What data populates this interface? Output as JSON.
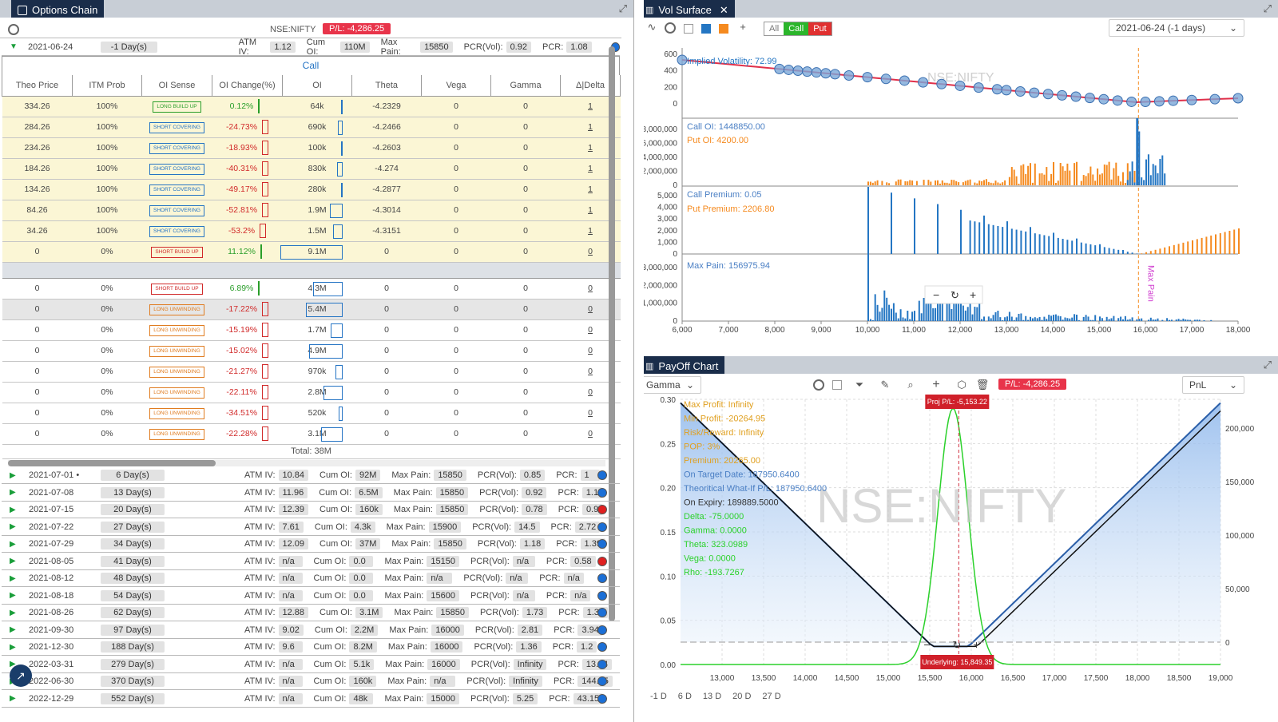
{
  "left": {
    "title": "Options Chain",
    "symbol": "NSE:NIFTY",
    "pnl": "P/L: -4,286.25",
    "expanded": {
      "date": "2021-06-24",
      "days": "-1 Day(s)",
      "atm_iv_label": "ATM IV:",
      "atm_iv": "1.12",
      "cum_oi_label": "Cum OI:",
      "cum_oi": "110M",
      "max_pain_label": "Max Pain:",
      "max_pain": "15850",
      "pcr_vol_label": "PCR(Vol):",
      "pcr_vol": "0.92",
      "pcr_label": "PCR:",
      "pcr": "1.08"
    },
    "call_label": "Call",
    "columns": [
      "Theo Price",
      "ITM Prob",
      "OI Sense",
      "OI Change(%)",
      "OI",
      "Theta",
      "Vega",
      "Gamma",
      "Δ|Delta"
    ],
    "itm_rows": [
      {
        "theo": "334.26",
        "prob": "100%",
        "sense": "LONG BUILD UP",
        "cls": "b-lbu",
        "chg": "0.12%",
        "dir": "pos",
        "oi": "64k",
        "oif": 0.02,
        "theta": "-4.2329",
        "vega": "0",
        "gamma": "0",
        "delta": "1"
      },
      {
        "theo": "284.26",
        "prob": "100%",
        "sense": "SHORT COVERING",
        "cls": "b-sc",
        "chg": "-24.73%",
        "dir": "neg",
        "oi": "690k",
        "oif": 0.08,
        "theta": "-4.2466",
        "vega": "0",
        "gamma": "0",
        "delta": "1"
      },
      {
        "theo": "234.26",
        "prob": "100%",
        "sense": "SHORT COVERING",
        "cls": "b-sc",
        "chg": "-18.93%",
        "dir": "neg",
        "oi": "100k",
        "oif": 0.02,
        "theta": "-4.2603",
        "vega": "0",
        "gamma": "0",
        "delta": "1"
      },
      {
        "theo": "184.26",
        "prob": "100%",
        "sense": "SHORT COVERING",
        "cls": "b-sc",
        "chg": "-40.31%",
        "dir": "neg",
        "oi": "830k",
        "oif": 0.09,
        "theta": "-4.274",
        "vega": "0",
        "gamma": "0",
        "delta": "1"
      },
      {
        "theo": "134.26",
        "prob": "100%",
        "sense": "SHORT COVERING",
        "cls": "b-sc",
        "chg": "-49.17%",
        "dir": "neg",
        "oi": "280k",
        "oif": 0.03,
        "theta": "-4.2877",
        "vega": "0",
        "gamma": "0",
        "delta": "1"
      },
      {
        "theo": "84.26",
        "prob": "100%",
        "sense": "SHORT COVERING",
        "cls": "b-sc",
        "chg": "-52.81%",
        "dir": "neg",
        "oi": "1.9M",
        "oif": 0.2,
        "theta": "-4.3014",
        "vega": "0",
        "gamma": "0",
        "delta": "1"
      },
      {
        "theo": "34.26",
        "prob": "100%",
        "sense": "SHORT COVERING",
        "cls": "b-sc",
        "chg": "-53.2%",
        "dir": "neg",
        "oi": "1.5M",
        "oif": 0.16,
        "theta": "-4.3151",
        "vega": "0",
        "gamma": "0",
        "delta": "1"
      },
      {
        "theo": "0",
        "prob": "0%",
        "sense": "SHORT BUILD UP",
        "cls": "b-sbu",
        "chg": "11.12%",
        "dir": "pos",
        "oi": "9.1M",
        "oif": 1.0,
        "theta": "0",
        "vega": "0",
        "gamma": "0",
        "delta": "0"
      }
    ],
    "otm_rows": [
      {
        "theo": "0",
        "prob": "0%",
        "sense": "SHORT BUILD UP",
        "cls": "b-sbu",
        "chg": "6.89%",
        "dir": "pos",
        "oi": "4.3M",
        "oif": 0.47,
        "theta": "0",
        "vega": "0",
        "gamma": "0",
        "delta": "0"
      },
      {
        "theo": "0",
        "prob": "0%",
        "sense": "LONG UNWINDING",
        "cls": "b-lu",
        "chg": "-17.22%",
        "dir": "neg",
        "oi": "5.4M",
        "oif": 0.59,
        "theta": "0",
        "vega": "0",
        "gamma": "0",
        "delta": "0"
      },
      {
        "theo": "0",
        "prob": "0%",
        "sense": "LONG UNWINDING",
        "cls": "b-lu",
        "chg": "-15.19%",
        "dir": "neg",
        "oi": "1.7M",
        "oif": 0.19,
        "theta": "0",
        "vega": "0",
        "gamma": "0",
        "delta": "0"
      },
      {
        "theo": "0",
        "prob": "0%",
        "sense": "LONG UNWINDING",
        "cls": "b-lu",
        "chg": "-15.02%",
        "dir": "neg",
        "oi": "4.9M",
        "oif": 0.54,
        "theta": "0",
        "vega": "0",
        "gamma": "0",
        "delta": "0"
      },
      {
        "theo": "0",
        "prob": "0%",
        "sense": "LONG UNWINDING",
        "cls": "b-lu",
        "chg": "-21.27%",
        "dir": "neg",
        "oi": "970k",
        "oif": 0.11,
        "theta": "0",
        "vega": "0",
        "gamma": "0",
        "delta": "0"
      },
      {
        "theo": "0",
        "prob": "0%",
        "sense": "LONG UNWINDING",
        "cls": "b-lu",
        "chg": "-22.11%",
        "dir": "neg",
        "oi": "2.8M",
        "oif": 0.31,
        "theta": "0",
        "vega": "0",
        "gamma": "0",
        "delta": "0"
      },
      {
        "theo": "0",
        "prob": "0%",
        "sense": "LONG UNWINDING",
        "cls": "b-lu",
        "chg": "-34.51%",
        "dir": "neg",
        "oi": "520k",
        "oif": 0.06,
        "theta": "0",
        "vega": "0",
        "gamma": "0",
        "delta": "0"
      },
      {
        "theo": "0",
        "prob": "0%",
        "sense": "LONG UNWINDING",
        "cls": "b-lu",
        "chg": "-22.28%",
        "dir": "neg",
        "oi": "3.1M",
        "oif": 0.34,
        "theta": "0",
        "vega": "0",
        "gamma": "0",
        "delta": "0"
      }
    ],
    "total": "Total: 38M",
    "expiries": [
      {
        "date": "2021-07-01 •",
        "days": "6 Day(s)",
        "iv": "10.84",
        "oi": "92M",
        "mp": "15850",
        "pv": "0.85",
        "pcr": "1",
        "dot": "blue"
      },
      {
        "date": "2021-07-08",
        "days": "13 Day(s)",
        "iv": "11.96",
        "oi": "6.5M",
        "mp": "15850",
        "pv": "0.92",
        "pcr": "1.1",
        "dot": "blue"
      },
      {
        "date": "2021-07-15",
        "days": "20 Day(s)",
        "iv": "12.39",
        "oi": "160k",
        "mp": "15850",
        "pv": "0.78",
        "pcr": "0.9",
        "dot": "red"
      },
      {
        "date": "2021-07-22",
        "days": "27 Day(s)",
        "iv": "7.61",
        "oi": "4.3k",
        "mp": "15900",
        "pv": "14.5",
        "pcr": "2.72",
        "dot": "blue"
      },
      {
        "date": "2021-07-29",
        "days": "34 Day(s)",
        "iv": "12.09",
        "oi": "37M",
        "mp": "15850",
        "pv": "1.18",
        "pcr": "1.39",
        "dot": "blue"
      },
      {
        "date": "2021-08-05",
        "days": "41 Day(s)",
        "iv": "n/a",
        "oi": "0.0",
        "mp": "15150",
        "pv": "n/a",
        "pcr": "0.58",
        "dot": "red"
      },
      {
        "date": "2021-08-12",
        "days": "48 Day(s)",
        "iv": "n/a",
        "oi": "0.0",
        "mp": "n/a",
        "pv": "n/a",
        "pcr": "n/a",
        "dot": "blue"
      },
      {
        "date": "2021-08-18",
        "days": "54 Day(s)",
        "iv": "n/a",
        "oi": "0.0",
        "mp": "15600",
        "pv": "n/a",
        "pcr": "n/a",
        "dot": "blue"
      },
      {
        "date": "2021-08-26",
        "days": "62 Day(s)",
        "iv": "12.88",
        "oi": "3.1M",
        "mp": "15850",
        "pv": "1.73",
        "pcr": "1.34",
        "dot": "blue"
      },
      {
        "date": "2021-09-30",
        "days": "97 Day(s)",
        "iv": "9.02",
        "oi": "2.2M",
        "mp": "16000",
        "pv": "2.81",
        "pcr": "3.94",
        "dot": "blue"
      },
      {
        "date": "2021-12-30",
        "days": "188 Day(s)",
        "iv": "9.6",
        "oi": "8.2M",
        "mp": "16000",
        "pv": "1.36",
        "pcr": "1.2",
        "dot": "blue"
      },
      {
        "date": "2022-03-31",
        "days": "279 Day(s)",
        "iv": "n/a",
        "oi": "5.1k",
        "mp": "16000",
        "pv": "Infinity",
        "pcr": "13.34",
        "dot": "blue"
      },
      {
        "date": "2022-06-30",
        "days": "370 Day(s)",
        "iv": "n/a",
        "oi": "160k",
        "mp": "n/a",
        "pv": "Infinity",
        "pcr": "144.45",
        "dot": "blue"
      },
      {
        "date": "2022-12-29",
        "days": "552 Day(s)",
        "iv": "n/a",
        "oi": "48k",
        "mp": "15000",
        "pv": "5.25",
        "pcr": "43.15",
        "dot": "blue"
      }
    ]
  },
  "vol": {
    "title": "Vol Surface",
    "seg": [
      "All",
      "Call",
      "Put"
    ],
    "date": "2021-06-24 (-1 days)",
    "watermark": "NSE:NIFTY",
    "iv_label": "Implied Volatility: 72.99",
    "call_oi": "Call OI: 1448850.00",
    "put_oi": "Put OI: 4200.00",
    "call_prem": "Call Premium: 0.05",
    "put_prem": "Put Premium: 2206.80",
    "max_pain": "Max Pain: 156975.94",
    "max_pain_vert": "Max Pain",
    "x_ticks": [
      "6,000",
      "7,000",
      "8,000",
      "9,000",
      "10,000",
      "11,000",
      "12,000",
      "13,000",
      "14,000",
      "15,000",
      "16,000",
      "17,000",
      "18,000"
    ],
    "y1": [
      "600",
      "400",
      "200",
      "0"
    ],
    "y2": [
      "8,000,000",
      "6,000,000",
      "4,000,000",
      "2,000,000",
      "0"
    ],
    "y3": [
      "5,000",
      "4,000",
      "3,000",
      "2,000",
      "1,000",
      "0"
    ],
    "y4": [
      "3,000,000",
      "2,000,000",
      "1,000,000",
      "0"
    ]
  },
  "payoff": {
    "title": "PayOff Chart",
    "greek": "Gamma",
    "pnl": "P/L: -4,286.25",
    "mode": "PnL",
    "watermark": "NSE:NIFTY",
    "proj": "Proj P/L: -5,153.22",
    "underlying": "Underlying: 15,849.35",
    "stats": [
      {
        "t": "Max Profit: Infinity",
        "c": "#e0a020"
      },
      {
        "t": "Min Profit: -20264.95",
        "c": "#e0a020"
      },
      {
        "t": "Risk/Reward: Infinity",
        "c": "#e0a020"
      },
      {
        "t": "POP: 3%",
        "c": "#e0a020"
      },
      {
        "t": "Premium: 20265.00",
        "c": "#e0a020"
      },
      {
        "t": "On Target Date: 187950.6400",
        "c": "#4a7fc4"
      },
      {
        "t": "Theoritical What-If P/L: 187950.6400",
        "c": "#4a7fc4"
      },
      {
        "t": "On Expiry: 189889.5000",
        "c": "#333333"
      },
      {
        "t": "Delta: -75.0000",
        "c": "#2bd12b"
      },
      {
        "t": "Gamma: 0.0000",
        "c": "#2bd12b"
      },
      {
        "t": "Theta: 323.0989",
        "c": "#2bd12b"
      },
      {
        "t": "Vega: 0.0000",
        "c": "#2bd12b"
      },
      {
        "t": "Rho: -193.7267",
        "c": "#2bd12b"
      }
    ],
    "x_ticks": [
      "13,000",
      "13,500",
      "14,000",
      "14,500",
      "15,000",
      "15,500",
      "16,000",
      "16,500",
      "17,000",
      "17,500",
      "18,000",
      "18,500",
      "19,000"
    ],
    "y_left": [
      "0.30",
      "0.25",
      "0.20",
      "0.15",
      "0.10",
      "0.05",
      "0.00"
    ],
    "y_right": [
      "200,000",
      "150,000",
      "100,000",
      "50,000",
      "0"
    ],
    "day_buttons": [
      "-1 D",
      "6 D",
      "13 D",
      "20 D",
      "27 D"
    ]
  },
  "colors": {
    "blue": "#2476c3",
    "orange": "#f58a1f",
    "red": "#e02030",
    "green": "#2bd12b",
    "navy": "#1a2d4a"
  }
}
